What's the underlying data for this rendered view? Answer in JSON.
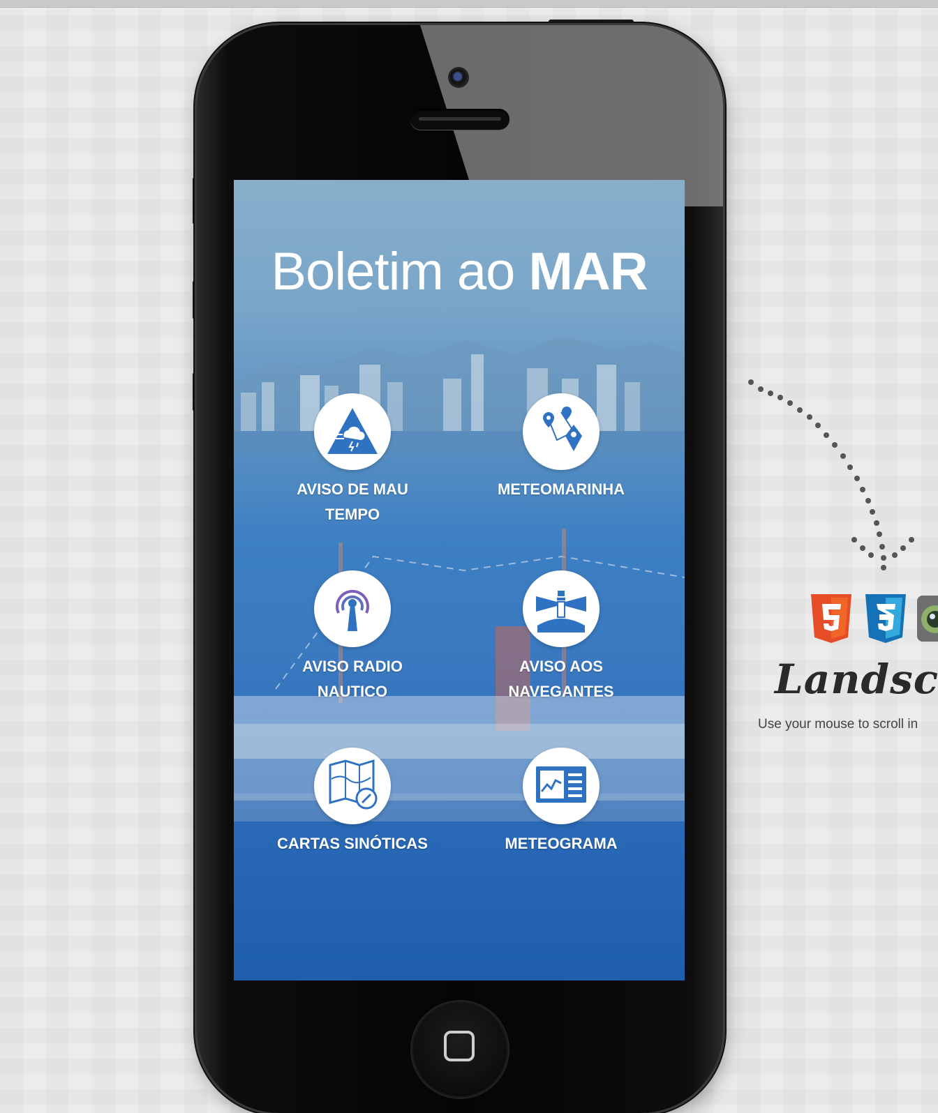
{
  "app": {
    "title_light": "Boletim ao ",
    "title_bold": "MAR"
  },
  "menu": [
    {
      "label": "AVISO DE MAU\nTEMPO",
      "icon": "storm-warning-icon"
    },
    {
      "label": "METEOMARINHA",
      "icon": "map-pins-icon"
    },
    {
      "label": "AVISO RADIO\nNAUTICO",
      "icon": "radio-antenna-icon"
    },
    {
      "label": "AVISO AOS\nNAVEGANTES",
      "icon": "lighthouse-icon"
    },
    {
      "label": "CARTAS SINÓTICAS",
      "icon": "map-compass-icon"
    },
    {
      "label": "METEOGRAMA",
      "icon": "chart-document-icon"
    }
  ],
  "side": {
    "badges": [
      "html5-icon",
      "css3-icon",
      "photo-icon"
    ],
    "orientation_label": "Landsca",
    "hint": "Use your mouse to scroll in"
  },
  "colors": {
    "accent_blue": "#2f6fb8",
    "icon_blue": "#2f72c2",
    "html5_orange": "#e44d26",
    "css3_blue": "#1572b6"
  }
}
